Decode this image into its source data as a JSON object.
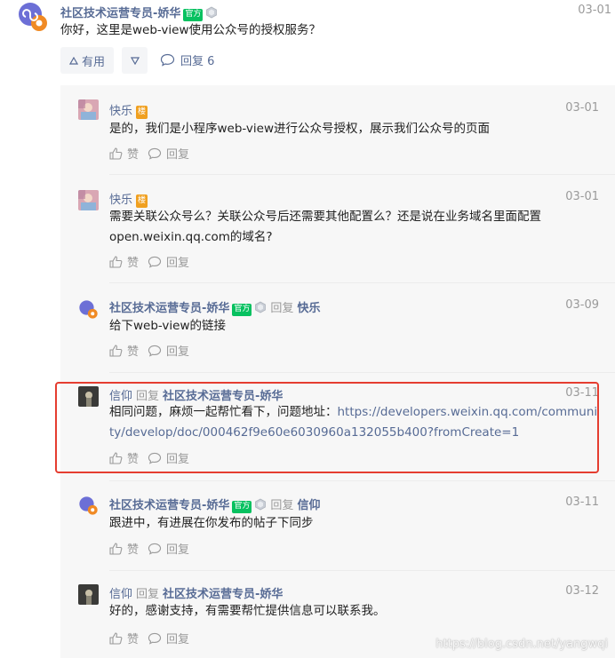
{
  "top": {
    "author": "社区技术运营专员-娇华",
    "official_badge": "官方",
    "date": "03-01",
    "text": "你好，这里是web-view使用公众号的授权服务？",
    "useful_label": "有用",
    "reply_label": "回复 6"
  },
  "labels": {
    "like": "赞",
    "reply": "回复",
    "reply_word": "回复"
  },
  "comments": [
    {
      "author": "快乐",
      "floor_badge": "楼",
      "date": "03-01",
      "text": "是的，我们是小程序web-view进行公众号授权，展示我们公众号的页面"
    },
    {
      "author": "快乐",
      "floor_badge": "楼",
      "date": "03-01",
      "text": "需要关联公众号么？关联公众号后还需要其他配置么？还是说在业务域名里面配置open.weixin.qq.com的域名?"
    },
    {
      "author": "社区技术运营专员-娇华",
      "official_badge": "官方",
      "reply_to": "快乐",
      "date": "03-09",
      "text": "给下web-view的链接"
    },
    {
      "author": "信仰",
      "reply_to": "社区技术运营专员-娇华",
      "date": "03-11",
      "text": "相同问题，麻烦一起帮忙看下，问题地址：",
      "link": "https://developers.weixin.qq.com/community/develop/doc/000462f9e60e6030960a132055b400?fromCreate=1"
    },
    {
      "author": "社区技术运营专员-娇华",
      "official_badge": "官方",
      "reply_to": "信仰",
      "date": "03-11",
      "text": "跟进中，有进展在你发布的帖子下同步"
    },
    {
      "author": "信仰",
      "reply_to": "社区技术运营专员-娇华",
      "date": "03-12",
      "text": "好的，感谢支持，有需要帮忙提供信息可以联系我。"
    }
  ],
  "watermark": "https://blog.csdn.net/yangwqi",
  "colors": {
    "link": "#576b95",
    "official": "#07c160",
    "floor": "#f0a020",
    "highlight": "#e53d30"
  }
}
